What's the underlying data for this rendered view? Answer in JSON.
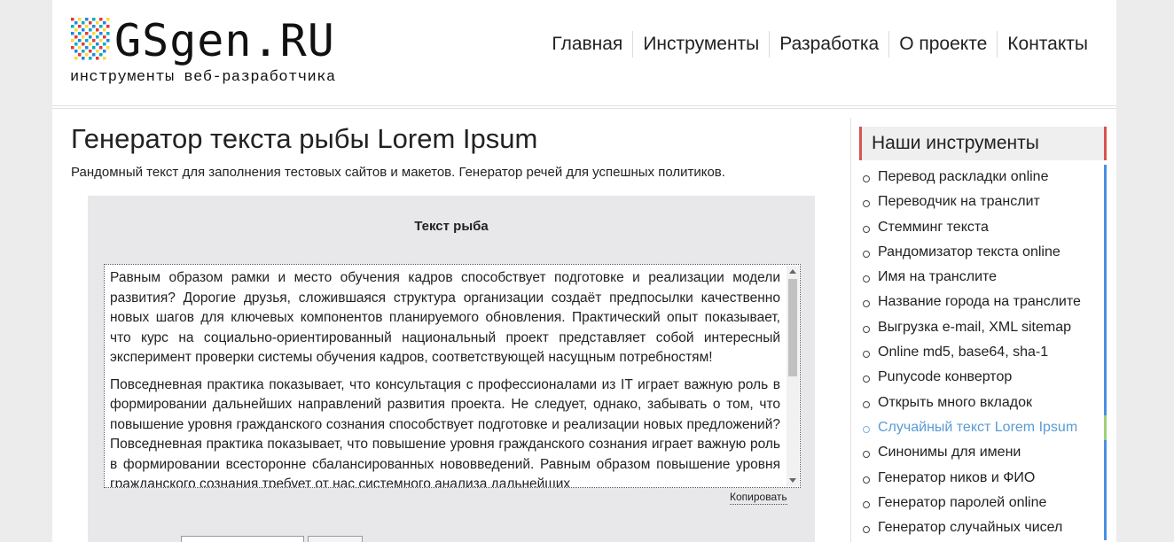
{
  "header": {
    "logo": "GSgen.RU",
    "tagline": "инструменты веб-разработчика",
    "nav": [
      "Главная",
      "Инструменты",
      "Разработка",
      "О проекте",
      "Контакты"
    ]
  },
  "main": {
    "title": "Генератор текста рыбы Lorem Ipsum",
    "description": "Рандомный текст для заполнения тестовых сайтов и макетов. Генератор речей для успешных политиков.",
    "panel_title": "Текст рыба",
    "paragraphs": [
      "Равным образом рамки и место обучения кадров способствует подготовке и реализации модели развития? Дорогие друзья, сложившаяся структура организации создаёт предпосылки качественно новых шагов для ключевых компонентов планируемого обновления. Практический опыт показывает, что курс на социально-ориентированный национальный проект представляет собой интересный эксперимент проверки системы обучения кадров, соответствующей насущным потребностям!",
      "Повседневная практика показывает, что консультация с профессионалами из IT играет важную роль в формировании дальнейших направлений развития проекта. Не следует, однако, забывать о том, что повышение уровня гражданского сознания способствует подготовке и реализации новых предложений? Повседневная практика показывает, что повышение уровня гражданского сознания играет важную роль в формировании всесторонне сбалансированных нововведений. Равным образом повышение уровня гражданского сознания требует от нас системного анализа дальнейших"
    ],
    "copy_label": "Копировать"
  },
  "sidebar": {
    "heading": "Наши инструменты",
    "tools": [
      "Перевод раскладки online",
      "Переводчик на транслит",
      "Стемминг текста",
      "Рандомизатор текста online",
      "Имя на транслите",
      "Название города на транслите",
      "Выгрузка e-mail, XML sitemap",
      "Online md5, base64, sha-1",
      "Punycode конвертор",
      "Открыть много вкладок",
      "Случайный текст Lorem Ipsum",
      "Синонимы для имени",
      "Генератор ников и ФИО",
      "Генератор паролей online",
      "Генератор случайных чисел"
    ],
    "active_index": 10
  },
  "colors": {
    "sidebar_accent": "#d9534f",
    "list_accent": "#4a90e2",
    "active_link": "#5a9bd5"
  }
}
